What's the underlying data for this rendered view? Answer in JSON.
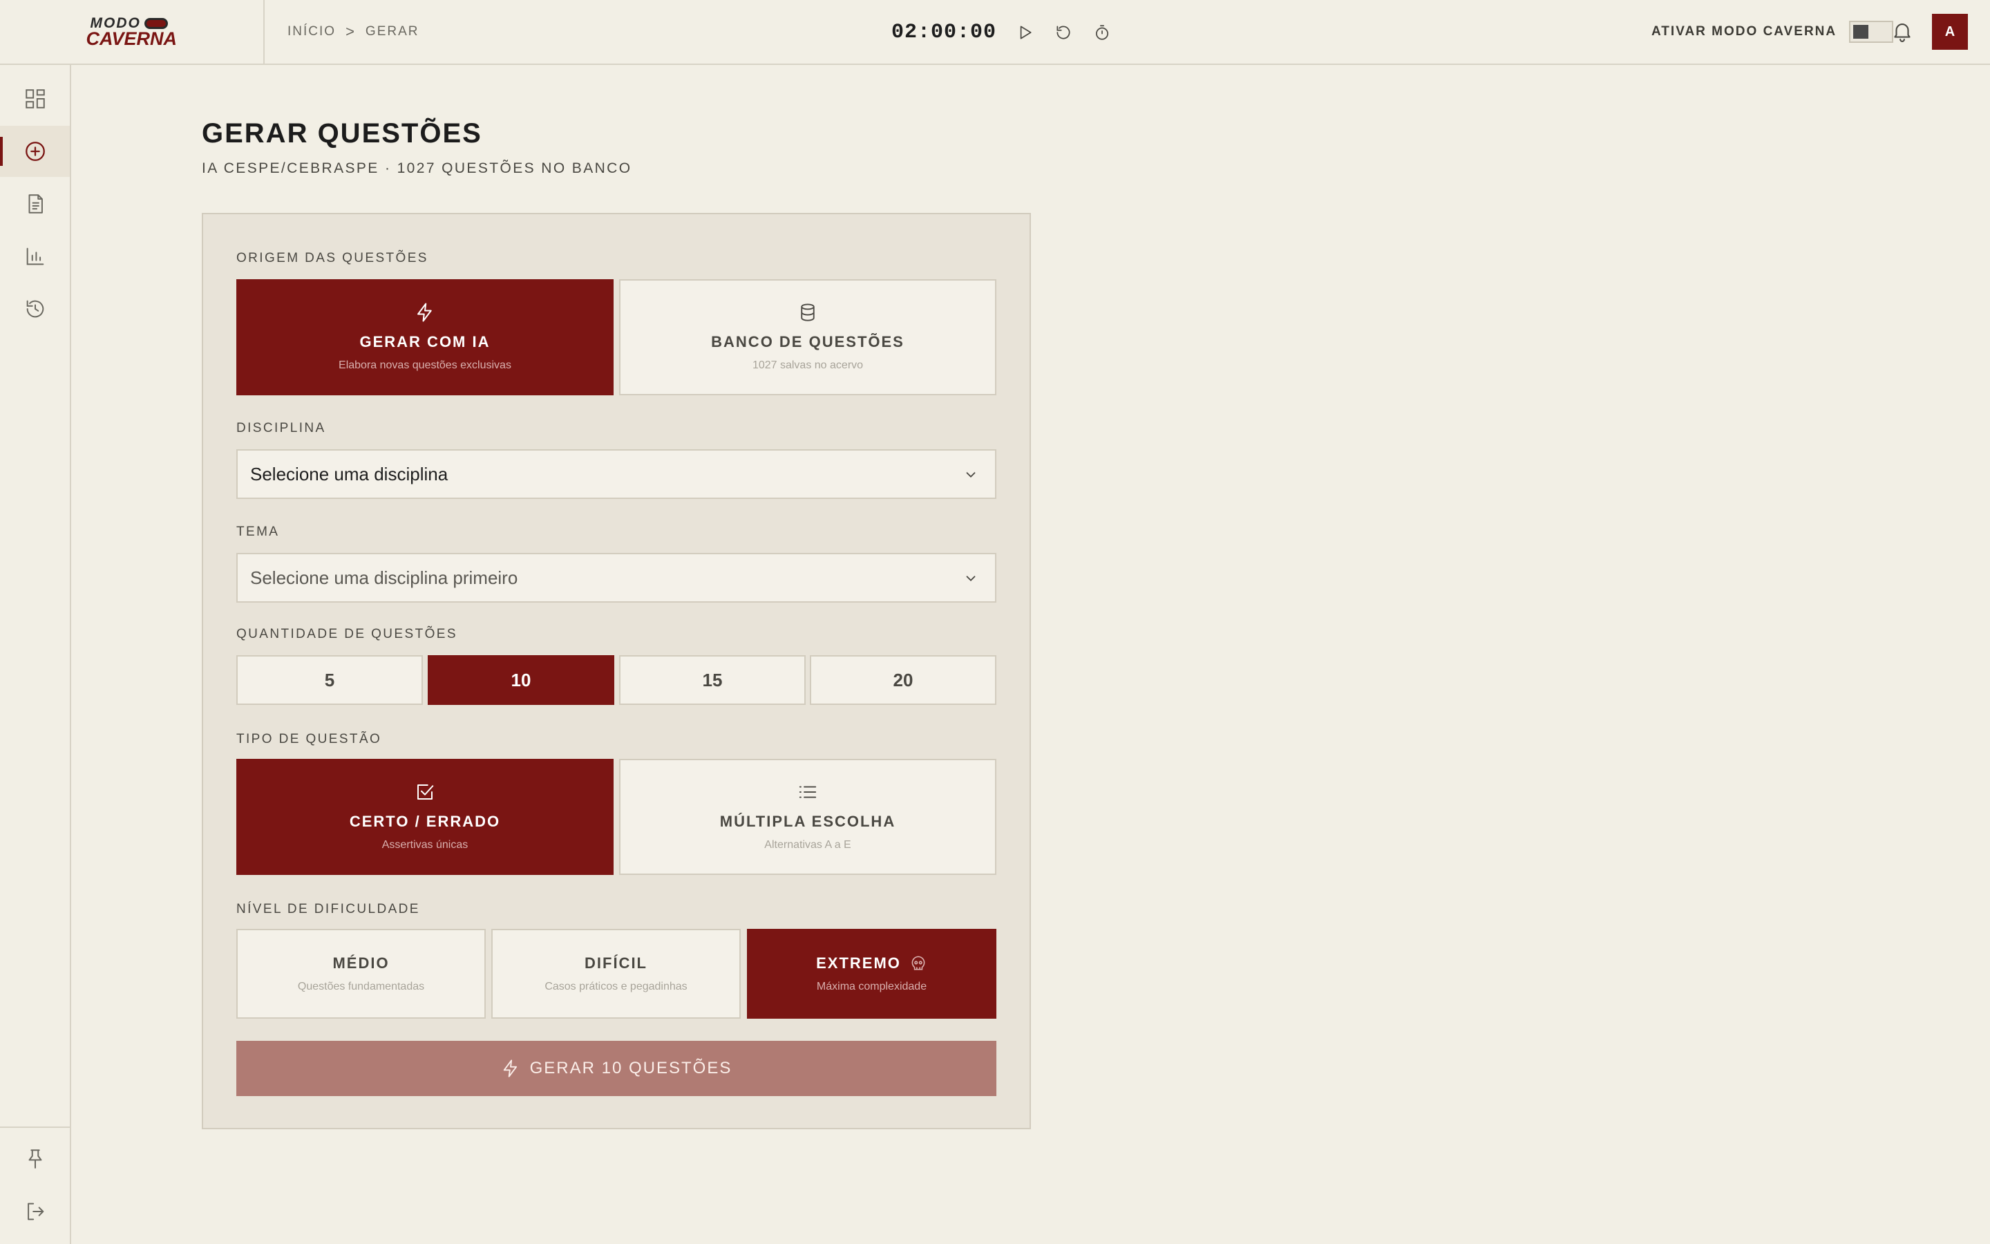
{
  "brand": {
    "logo_line1": "MODO",
    "logo_line2": "CAVERNA"
  },
  "breadcrumb": {
    "home": "INÍCIO",
    "separator": ">",
    "current": "GERAR"
  },
  "timer": {
    "value": "02:00:00",
    "controls": [
      "play-icon",
      "reset-icon",
      "stopwatch-icon"
    ]
  },
  "cave_mode": {
    "label": "ATIVAR MODO CAVERNA",
    "enabled": false
  },
  "user": {
    "avatar_initial": "A"
  },
  "sidebar": {
    "items": [
      {
        "name": "dashboard",
        "icon": "grid-icon",
        "active": false
      },
      {
        "name": "gerar",
        "icon": "plus-circle-icon",
        "active": true
      },
      {
        "name": "documentos",
        "icon": "document-icon",
        "active": false
      },
      {
        "name": "estatisticas",
        "icon": "bar-chart-icon",
        "active": false
      },
      {
        "name": "historico",
        "icon": "history-icon",
        "active": false
      }
    ],
    "bottom": [
      {
        "name": "fixar",
        "icon": "pin-icon"
      },
      {
        "name": "sair",
        "icon": "logout-icon"
      }
    ]
  },
  "page": {
    "title": "GERAR QUESTÕES",
    "subtitle": "IA CESPE/CEBRASPE · 1027 QUESTÕES NO BANCO"
  },
  "form": {
    "origin": {
      "label": "ORIGEM DAS QUESTÕES",
      "options": [
        {
          "title": "GERAR COM IA",
          "desc": "Elabora novas questões exclusivas",
          "icon": "lightning-icon",
          "active": true
        },
        {
          "title": "BANCO DE QUESTÕES",
          "desc": "1027 salvas no acervo",
          "icon": "database-icon",
          "active": false
        }
      ]
    },
    "discipline": {
      "label": "DISCIPLINA",
      "value": "Selecione uma disciplina"
    },
    "theme": {
      "label": "TEMA",
      "value": "Selecione uma disciplina primeiro"
    },
    "quantity": {
      "label": "QUANTIDADE DE QUESTÕES",
      "options": [
        "5",
        "10",
        "15",
        "20"
      ],
      "selected": "10"
    },
    "type": {
      "label": "TIPO DE QUESTÃO",
      "options": [
        {
          "title": "CERTO / ERRADO",
          "desc": "Assertivas únicas",
          "icon": "checkbox-icon",
          "active": true
        },
        {
          "title": "MÚLTIPLA ESCOLHA",
          "desc": "Alternativas A a E",
          "icon": "list-icon",
          "active": false
        }
      ]
    },
    "difficulty": {
      "label": "NÍVEL DE DIFICULDADE",
      "options": [
        {
          "title": "MÉDIO",
          "desc": "Questões fundamentadas",
          "active": false
        },
        {
          "title": "DIFÍCIL",
          "desc": "Casos práticos e pegadinhas",
          "active": false
        },
        {
          "title": "EXTREMO",
          "desc": "Máxima complexidade",
          "icon": "skull-icon",
          "active": true
        }
      ]
    },
    "submit": {
      "label": "GERAR 10 QUESTÕES",
      "icon": "lightning-icon"
    }
  },
  "colors": {
    "accent": "#7a1513",
    "background": "#f2efe5",
    "card": "#e8e3d8",
    "submit_disabled": "#b07b73"
  }
}
